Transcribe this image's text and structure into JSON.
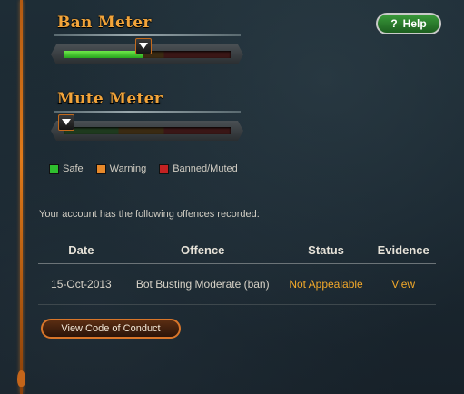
{
  "meters": {
    "ban": {
      "title": "Ban Meter",
      "level": 0.48
    },
    "mute": {
      "title": "Mute Meter",
      "level": 0.0
    }
  },
  "help": {
    "label": "Help",
    "icon": "question-icon",
    "icon_glyph": "?"
  },
  "legend": [
    {
      "label": "Safe",
      "color": "#2fbf2f"
    },
    {
      "label": "Warning",
      "color": "#e8892a"
    },
    {
      "label": "Banned/Muted",
      "color": "#c42222"
    }
  ],
  "notice": "Your account has the following offences recorded:",
  "table": {
    "headers": {
      "date": "Date",
      "offence": "Offence",
      "status": "Status",
      "evidence": "Evidence"
    },
    "rows": [
      {
        "date": "15-Oct-2013",
        "offence": "Bot Busting Moderate (ban)",
        "status": "Not Appealable",
        "evidence": "View"
      }
    ]
  },
  "code_of_conduct_button": "View Code of Conduct",
  "colors": {
    "accent": "#f2a43a",
    "help_green": "#2e8b2e",
    "status_orange": "#f2a82a"
  }
}
